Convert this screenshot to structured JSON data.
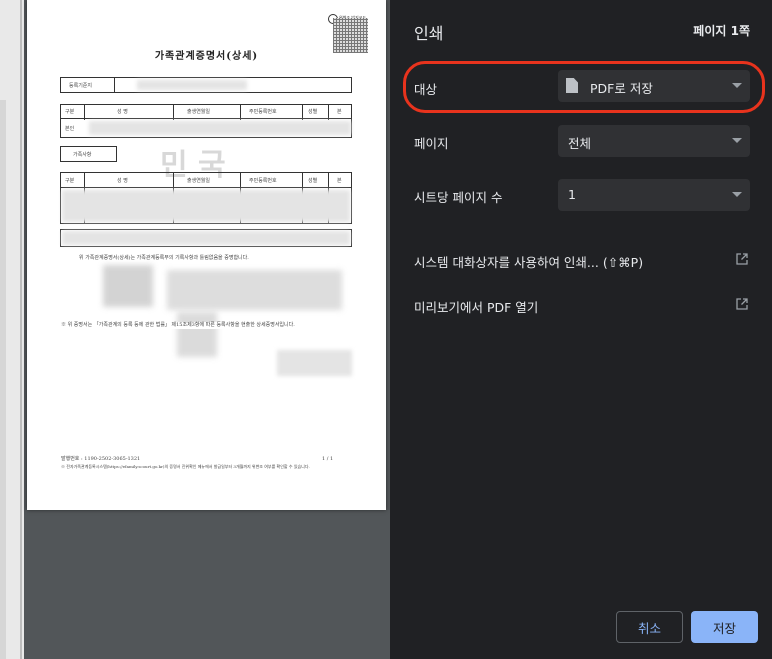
{
  "panel": {
    "title": "인쇄",
    "page_count": "페이지 1쪽",
    "destination": {
      "label": "대상",
      "value": "PDF로 저장",
      "icon": "file-icon"
    },
    "pages": {
      "label": "페이지",
      "value": "전체"
    },
    "pages_per_sheet": {
      "label": "시트당 페이지 수",
      "value": "1"
    },
    "system_dialog_link": "시스템 대화상자를 사용하여 인쇄... (⇧⌘P)",
    "open_pdf_link": "미리보기에서 PDF 열기",
    "cancel_label": "취소",
    "save_label": "저장",
    "highlight_color": "#e8331d",
    "accent_color": "#8ab4f8"
  },
  "document": {
    "title": "가족관계증명서(상세)",
    "qr_caption": "위변조 방지코드",
    "reg_label": "등록기준지",
    "header_cols": [
      "구분",
      "성 명",
      "출생연월일",
      "주민등록번호",
      "성별",
      "본"
    ],
    "self_label": "본인",
    "family_label": "가족사항",
    "family_cols": [
      "구분",
      "성 명",
      "출생연월일",
      "주민등록번호",
      "성별",
      "본"
    ],
    "certify_text": "위 가족관계증명서(상세)는 가족관계등록부의 기록사항과 틀림없음을 증명합니다.",
    "note_text": "※ 위 증명서는 「가족관계의 등록 등에 관한 법률」 제15조제3항에 따른 등록사항을 현출한 상세증명서입니다.",
    "issue_no": "발행번호 : 1190-2502-3065-1321",
    "page_no": "1 / 1",
    "footer_note": "※ 전자가족관계등록시스템(https://efamily.scourt.go.kr)의 증명서 진위확인 메뉴에서 발급일부터 3개월까지 위변조 여부를 확인할 수 있습니다."
  }
}
